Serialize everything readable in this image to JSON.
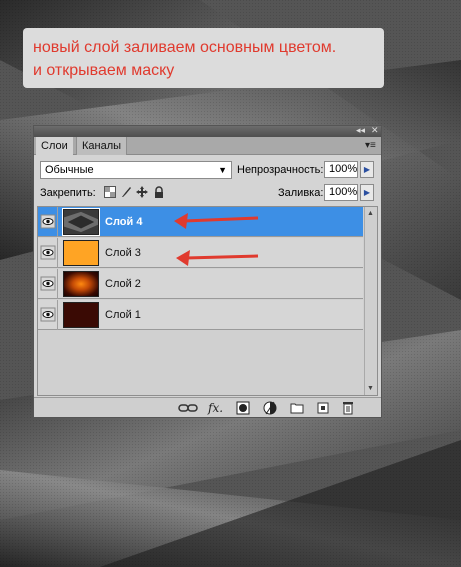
{
  "callout": {
    "line1": "новый слой заливаем основным цветом.",
    "line2": "и открываем маску"
  },
  "panel": {
    "tabs": [
      {
        "label": "Слои",
        "active": true
      },
      {
        "label": "Каналы",
        "active": false
      }
    ],
    "blend_mode": "Обычные",
    "opacity_label": "Непрозрачность:",
    "opacity_value": "100%",
    "lock_label": "Закрепить:",
    "fill_label": "Заливка:",
    "fill_value": "100%",
    "layers": [
      {
        "name": "Слой 4",
        "selected": true,
        "thumb": "dark-gray-pattern"
      },
      {
        "name": "Слой 3",
        "selected": false,
        "thumb": "orange-fill",
        "color": "#ffa424"
      },
      {
        "name": "Слой 2",
        "selected": false,
        "thumb": "orange-glow"
      },
      {
        "name": "Слой 1",
        "selected": false,
        "thumb": "dark-brown-fill",
        "color": "#3a0a04"
      }
    ],
    "footer_icons": [
      "link-icon",
      "fx-icon",
      "mask-icon",
      "adjustment-icon",
      "folder-icon",
      "new-layer-icon",
      "trash-icon"
    ]
  },
  "colors": {
    "callout_text": "#e03a2e",
    "selection": "#3d8fe5",
    "arrow": "#e03a2e"
  }
}
